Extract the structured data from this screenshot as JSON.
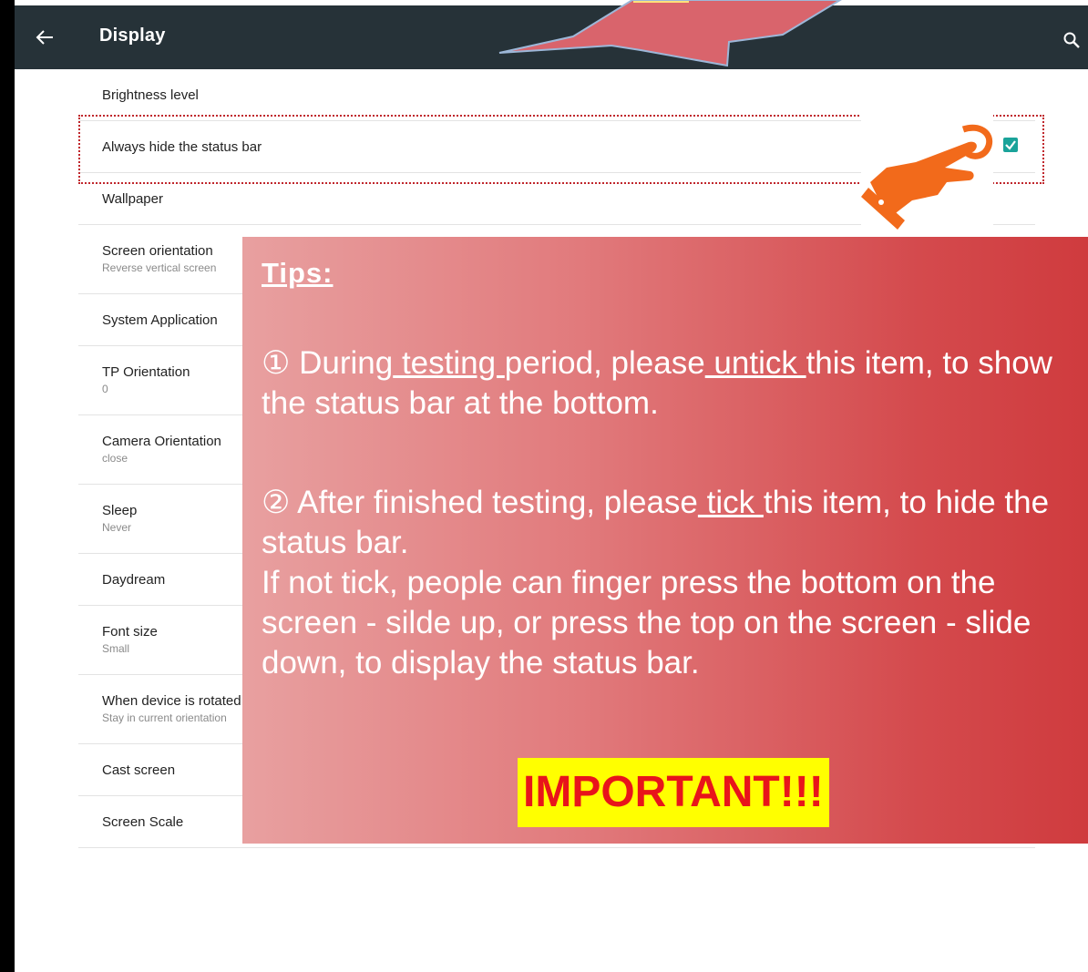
{
  "appbar": {
    "title": "Display",
    "back_icon": "arrow-left-icon",
    "search_icon": "search-icon"
  },
  "settings": {
    "items": [
      {
        "label": "Brightness level",
        "subtitle": ""
      },
      {
        "label": "Always hide the status bar",
        "subtitle": "",
        "checked": true
      },
      {
        "label": "Wallpaper",
        "subtitle": ""
      },
      {
        "label": "Screen orientation",
        "subtitle": "Reverse vertical screen"
      },
      {
        "label": "System Application",
        "subtitle": ""
      },
      {
        "label": "TP Orientation",
        "subtitle": "0"
      },
      {
        "label": "Camera Orientation",
        "subtitle": "close"
      },
      {
        "label": "Sleep",
        "subtitle": "Never"
      },
      {
        "label": "Daydream",
        "subtitle": ""
      },
      {
        "label": "Font size",
        "subtitle": "Small"
      },
      {
        "label": "When device is rotated",
        "subtitle": "Stay in current orientation"
      },
      {
        "label": "Cast screen",
        "subtitle": ""
      },
      {
        "label": "Screen Scale",
        "subtitle": ""
      }
    ]
  },
  "tips": {
    "heading": "Tips:",
    "tip1": {
      "marker": "①",
      "pre": " During",
      "u1": " testing ",
      "mid": "period, please",
      "u2": " untick ",
      "post": "this item, to show the status bar at the bottom."
    },
    "tip2": {
      "marker": "②",
      "pre": " After finished testing, please",
      "u1": " tick ",
      "post": "this item, to hide the status bar."
    },
    "tip3": "If not tick, people can finger press the bottom on the screen - silde up, or press the top on the screen - slide down, to display the status bar.",
    "important": "IMPORTANT!!!"
  },
  "colors": {
    "appbar": "#263238",
    "checkbox": "#1aa39a",
    "panel_start": "#e8a0a0",
    "panel_end": "#cf3b3e",
    "important_bg": "#ffff00",
    "important_text": "#e8141b",
    "highlight_border": "#c0262c",
    "hand": "#f26a1b"
  }
}
